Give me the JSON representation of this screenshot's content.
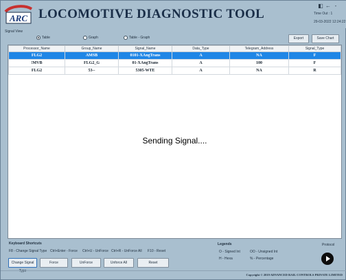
{
  "header": {
    "logo_text": "ARC",
    "title": "LOCOMOTIVE DIAGNOSTIC TOOL",
    "window_controls": [
      "◧",
      "←",
      "-"
    ],
    "timeout_label": "Time Out : 1",
    "datetime": "29-03-2022 12:24:22"
  },
  "signal_view": {
    "label": "Signal View",
    "view_options": [
      "Table",
      "Graph",
      "Table - Graph"
    ],
    "selected_view": "Table",
    "export_label": "Export",
    "save_chart_label": "Save Chart"
  },
  "table": {
    "columns": [
      "Processor_Name",
      "Group_Name",
      "Signal_Name",
      "Data_Type",
      "Telegram_Address",
      "Signal_Type"
    ],
    "rows": [
      [
        "FLG2",
        "AMSB",
        "0101-XAngTrans",
        "A",
        "NA",
        "F"
      ],
      [
        "!MVB",
        "FLG2_G",
        "01-XAngTrans",
        "A",
        "100",
        "F"
      ],
      [
        "FLG2",
        "53--",
        "5305-WTE",
        "A",
        "NA",
        "R"
      ]
    ],
    "selected_row_index": 0,
    "status_message": "Sending Signal...."
  },
  "shortcuts": {
    "title": "Keyboard Shortcuts",
    "items": [
      "F8 - Change Signal Type",
      "Ctrl+Enter - Force",
      "Ctrl+U - UnForce",
      "Ctrl+R - UnForce All",
      "F10 - Reset"
    ]
  },
  "actions": {
    "change_signal_type": "Change Signal Type",
    "force": "Force",
    "unforce": "UnForce",
    "unforce_all": "Unforce All",
    "reset": "Reset"
  },
  "legends": {
    "title": "Legends",
    "items": [
      "O - Signed Int",
      "OO - Unsigned Int",
      "H - Hexa",
      "% - Percentage"
    ]
  },
  "protocol": {
    "label": "Protocol",
    "play_icon": "play-icon"
  },
  "footer": {
    "copyright": "Copyright © 2019 ADVANCED RAIL CONTROLS PRIVATE LIMITED"
  },
  "colors": {
    "background": "#a9bfcf",
    "title": "#1b2f49",
    "selected_row": "#1f86e6"
  }
}
